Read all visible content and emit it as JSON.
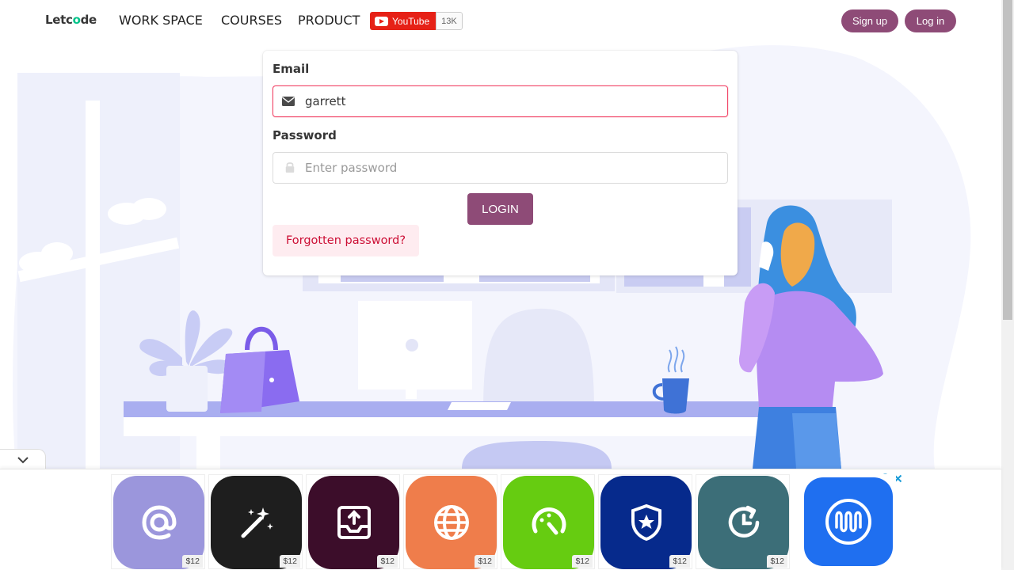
{
  "nav": {
    "logo_prefix": "Letc",
    "logo_accent": "o",
    "logo_suffix": "de",
    "items": [
      "WORK SPACE",
      "COURSES",
      "PRODUCT"
    ],
    "youtube_label": "YouTube",
    "youtube_count": "13K",
    "signup_label": "Sign up",
    "login_label": "Log in"
  },
  "form": {
    "email_label": "Email",
    "email_value": "garrett",
    "password_label": "Password",
    "password_placeholder": "Enter password",
    "login_button": "LOGIN",
    "forgot_link": "Forgotten password?"
  },
  "ads": {
    "tiles": [
      {
        "icon": "at-sign-icon",
        "color": "#9b96dc",
        "price": "$12"
      },
      {
        "icon": "magic-wand-icon",
        "color": "#1e1e1e",
        "price": "$12"
      },
      {
        "icon": "upload-tray-icon",
        "color": "#3c0d2a",
        "price": "$12"
      },
      {
        "icon": "globe-icon",
        "color": "#ef7d4b",
        "price": "$12"
      },
      {
        "icon": "speedometer-icon",
        "color": "#66cc11",
        "price": "$12"
      },
      {
        "icon": "shield-star-icon",
        "color": "#062a8c",
        "price": "$12"
      },
      {
        "icon": "clock-refresh-icon",
        "color": "#3c6e78",
        "price": "$12"
      },
      {
        "icon": "wave-logo-icon",
        "color": "#1f6ff0",
        "price": ""
      }
    ]
  },
  "colors": {
    "primary": "#8e4b77",
    "danger": "#f14668",
    "forgot_bg": "#feecf0",
    "forgot_text": "#cc0f35",
    "logo_accent": "#00c389"
  }
}
